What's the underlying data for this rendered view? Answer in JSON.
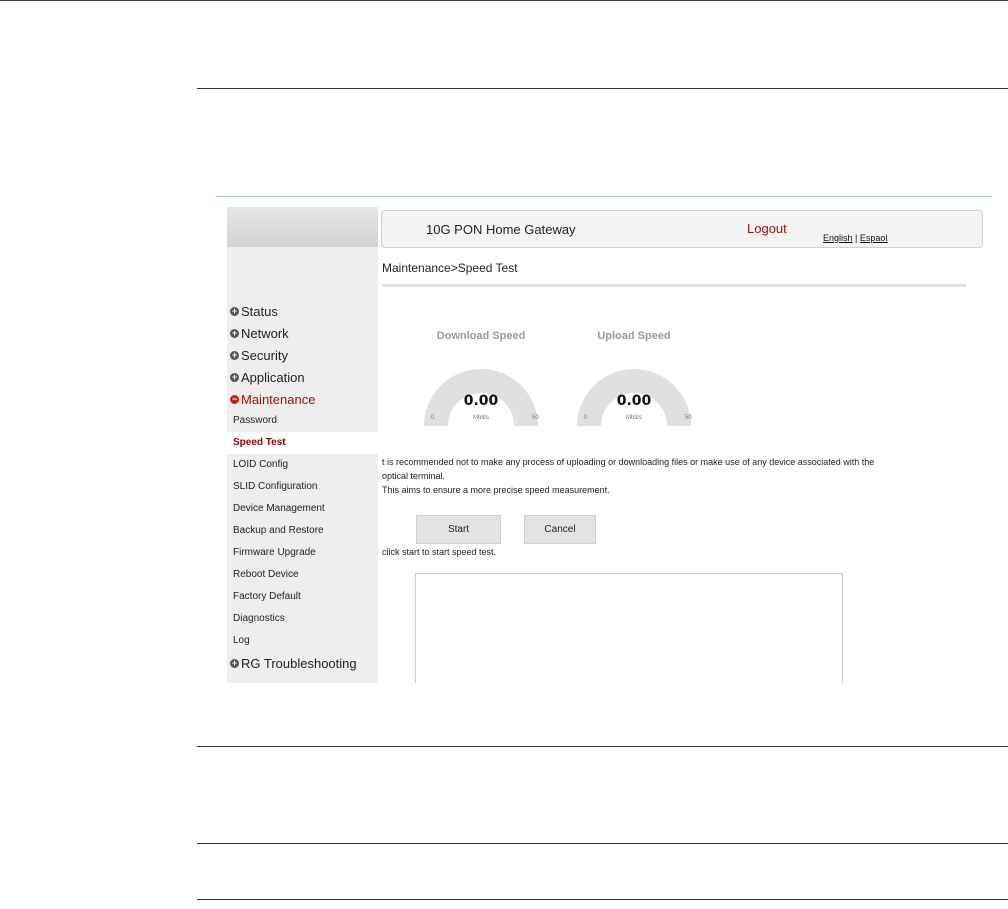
{
  "header": {
    "title": "10G PON Home Gateway",
    "logout": "Logout",
    "lang_english": "English",
    "lang_separator": "|",
    "lang_espanol": "Espaol"
  },
  "breadcrumb": "Maintenance>Speed Test",
  "sidebar": {
    "menu": [
      {
        "label": "Status",
        "expanded": false
      },
      {
        "label": "Network",
        "expanded": false
      },
      {
        "label": "Security",
        "expanded": false
      },
      {
        "label": "Application",
        "expanded": false
      },
      {
        "label": "Maintenance",
        "expanded": true
      }
    ],
    "submenu": [
      "Password",
      "Speed Test",
      "LOID Config",
      "SLID Configuration",
      "Device Management",
      "Backup and Restore",
      "Firmware Upgrade",
      "Reboot Device",
      "Factory Default",
      "Diagnostics",
      "Log"
    ],
    "current_submenu": "Speed Test",
    "last_menu": {
      "label": "RG Troubleshooting",
      "expanded": false
    }
  },
  "gauges": {
    "download": {
      "title": "Download Speed",
      "value": "0.00",
      "min": "0",
      "max": "50",
      "unit": "Mbit/s"
    },
    "upload": {
      "title": "Upload Speed",
      "value": "0.00",
      "min": "0",
      "max": "50",
      "unit": "Mbit/s"
    }
  },
  "note": {
    "line1": "t is recommended not to make any process of uploading or downloading files or make use of any device associated with the",
    "line2": "optical terminal.",
    "line3": "This aims to ensure a more precise speed measurement."
  },
  "buttons": {
    "start": "Start",
    "cancel": "Cancel"
  },
  "hint": "click start to start speed test.",
  "result_text": "",
  "colors": {
    "accent": "#a01010",
    "sidebar_bg": "#eeeeee",
    "gauge_track": "#e0e0e0"
  }
}
